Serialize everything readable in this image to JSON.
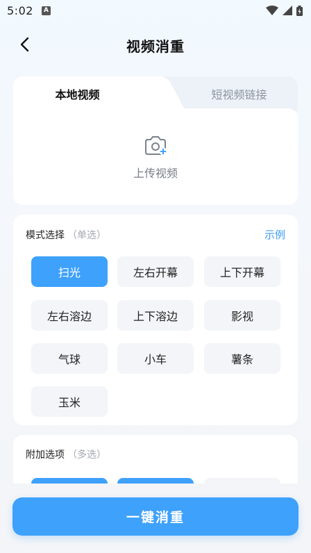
{
  "status": {
    "time": "5:02",
    "notif_letter": "A"
  },
  "nav": {
    "title": "视频消重"
  },
  "upload": {
    "tabs": [
      {
        "label": "本地视频",
        "active": true
      },
      {
        "label": "短视频链接",
        "active": false
      }
    ],
    "upload_label": "上传视频"
  },
  "mode": {
    "title": "模式选择",
    "hint": "（单选）",
    "example_label": "示例",
    "options": [
      {
        "label": "扫光",
        "selected": true
      },
      {
        "label": "左右开幕",
        "selected": false
      },
      {
        "label": "上下开幕",
        "selected": false
      },
      {
        "label": "左右溶边",
        "selected": false
      },
      {
        "label": "上下溶边",
        "selected": false
      },
      {
        "label": "影视",
        "selected": false
      },
      {
        "label": "气球",
        "selected": false
      },
      {
        "label": "小车",
        "selected": false
      },
      {
        "label": "薯条",
        "selected": false
      },
      {
        "label": "玉米",
        "selected": false
      }
    ]
  },
  "extra": {
    "title": "附加选项",
    "hint": "（多选）",
    "options_selected": [
      true,
      true,
      false
    ]
  },
  "action": {
    "label": "一键消重"
  },
  "colors": {
    "accent": "#3ea1fb",
    "option_bg": "#f3f5f8"
  }
}
